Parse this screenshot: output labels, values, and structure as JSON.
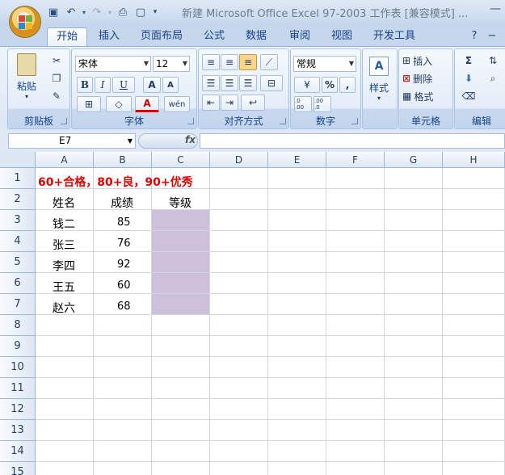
{
  "title": "新建 Microsoft Office Excel 97-2003 工作表  [兼容模式] ...",
  "tabs": [
    "开始",
    "插入",
    "页面布局",
    "公式",
    "数据",
    "审阅",
    "视图",
    "开发工具"
  ],
  "ribbon": {
    "clipboard": {
      "label": "剪贴板",
      "paste": "粘贴"
    },
    "font": {
      "label": "字体",
      "font_name": "宋体",
      "font_size": "12",
      "bold": "B",
      "italic": "I",
      "underline": "U",
      "grow": "A",
      "shrink": "A",
      "font_color": "A",
      "phonetic": "wén"
    },
    "align": {
      "label": "对齐方式"
    },
    "number": {
      "label": "数字",
      "format": "常规",
      "percent": "%",
      "comma": ",",
      "inc_dec": ".0 .00",
      "dec_dec": ".00 .0"
    },
    "styles": {
      "label": "样式"
    },
    "cells": {
      "label": "单元格",
      "insert": "插入",
      "delete": "删除",
      "format": "格式"
    },
    "editing": {
      "label": "编辑",
      "sum": "Σ"
    }
  },
  "formula_bar": {
    "name_box": "E7",
    "fx": "fx",
    "value": ""
  },
  "sheet": {
    "columns": [
      "A",
      "B",
      "C",
      "D",
      "E",
      "F",
      "G",
      "H"
    ],
    "rows": [
      "1",
      "2",
      "3",
      "4",
      "5",
      "6",
      "7",
      "8",
      "9",
      "10",
      "11",
      "12",
      "13",
      "14",
      "15"
    ],
    "a1": "60+合格，80+良，90+优秀",
    "headers": {
      "name": "姓名",
      "score": "成绩",
      "grade": "等级"
    },
    "data": [
      {
        "name": "钱二",
        "score": "85"
      },
      {
        "name": "张三",
        "score": "76"
      },
      {
        "name": "李四",
        "score": "92"
      },
      {
        "name": "王五",
        "score": "60"
      },
      {
        "name": "赵六",
        "score": "68"
      }
    ],
    "highlight_color": "#ccc0da",
    "a1_color": "#e00000"
  }
}
